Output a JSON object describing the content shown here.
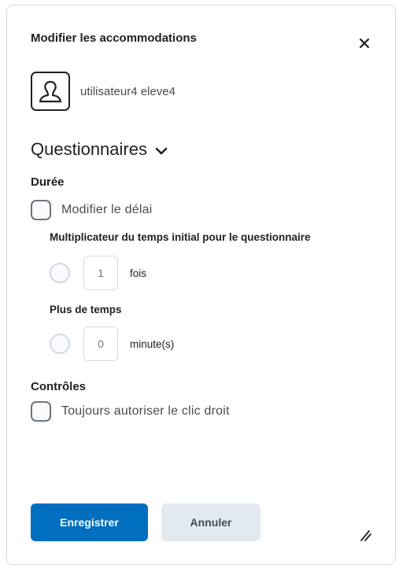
{
  "dialog": {
    "title": "Modifier les accommodations",
    "user_name": "utilisateur4 eleve4"
  },
  "section": {
    "title": "Questionnaires"
  },
  "duration": {
    "label": "Durée",
    "modify_delay_label": "Modifier le délai",
    "multiplier_label": "Multiplicateur du temps initial pour le questionnaire",
    "multiplier_placeholder": "1",
    "multiplier_unit": "fois",
    "extra_time_label": "Plus de temps",
    "extra_time_placeholder": "0",
    "extra_time_unit": "minute(s)"
  },
  "controls": {
    "label": "Contrôles",
    "right_click_label": "Toujours autoriser le clic droit"
  },
  "buttons": {
    "save_label": "Enregistrer",
    "cancel_label": "Annuler"
  },
  "colors": {
    "primary": "#006fbf",
    "secondary_bg": "#e3e9f1",
    "border": "#d3d9e3"
  }
}
